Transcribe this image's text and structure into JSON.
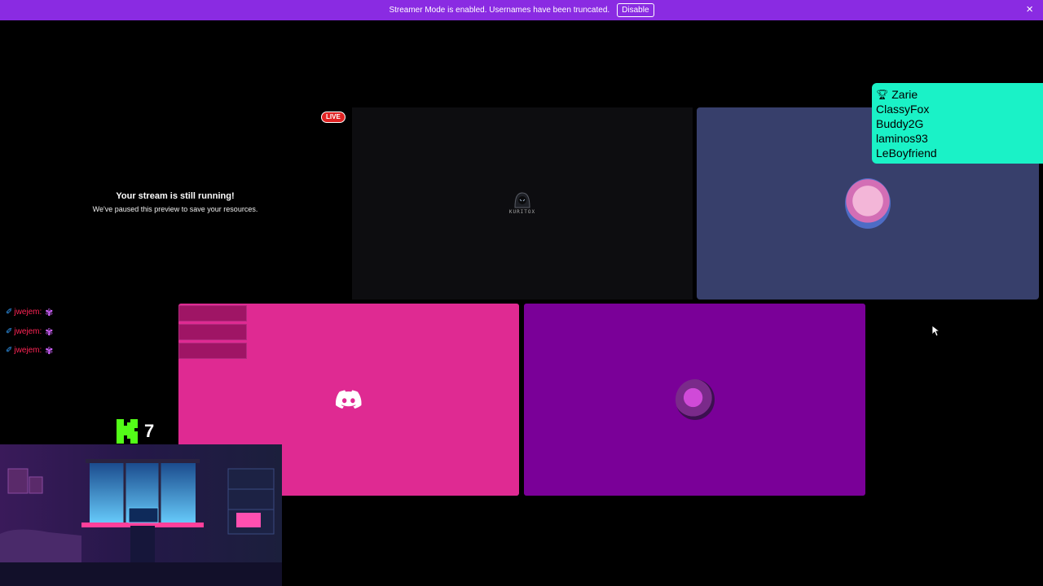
{
  "banner": {
    "message": "Streamer Mode is enabled. Usernames have been truncated.",
    "disable_label": "Disable",
    "close_icon": "×"
  },
  "preview": {
    "title": "Your stream is still running!",
    "subtitle": "We've paused this preview to save your resources.",
    "live_label": "LIVE"
  },
  "tiles": {
    "kuritox_text": "KURITOX"
  },
  "leaderboard": {
    "entries": [
      "Zarie",
      "ClassyFox",
      "Buddy2G",
      "laminos93",
      "LeBoyfriend"
    ]
  },
  "chat": {
    "lines": [
      {
        "user": "jwejem:"
      },
      {
        "user": "jwejem:"
      },
      {
        "user": "jwejem:"
      }
    ]
  },
  "kick": {
    "count": "7"
  },
  "colors": {
    "banner": "#8a2be2",
    "leaderboard": "#1af2c7",
    "tile_blue": "#373f6b",
    "tile_pink": "#df2a92",
    "tile_purple": "#7a0098",
    "kick_green": "#53fc18"
  }
}
